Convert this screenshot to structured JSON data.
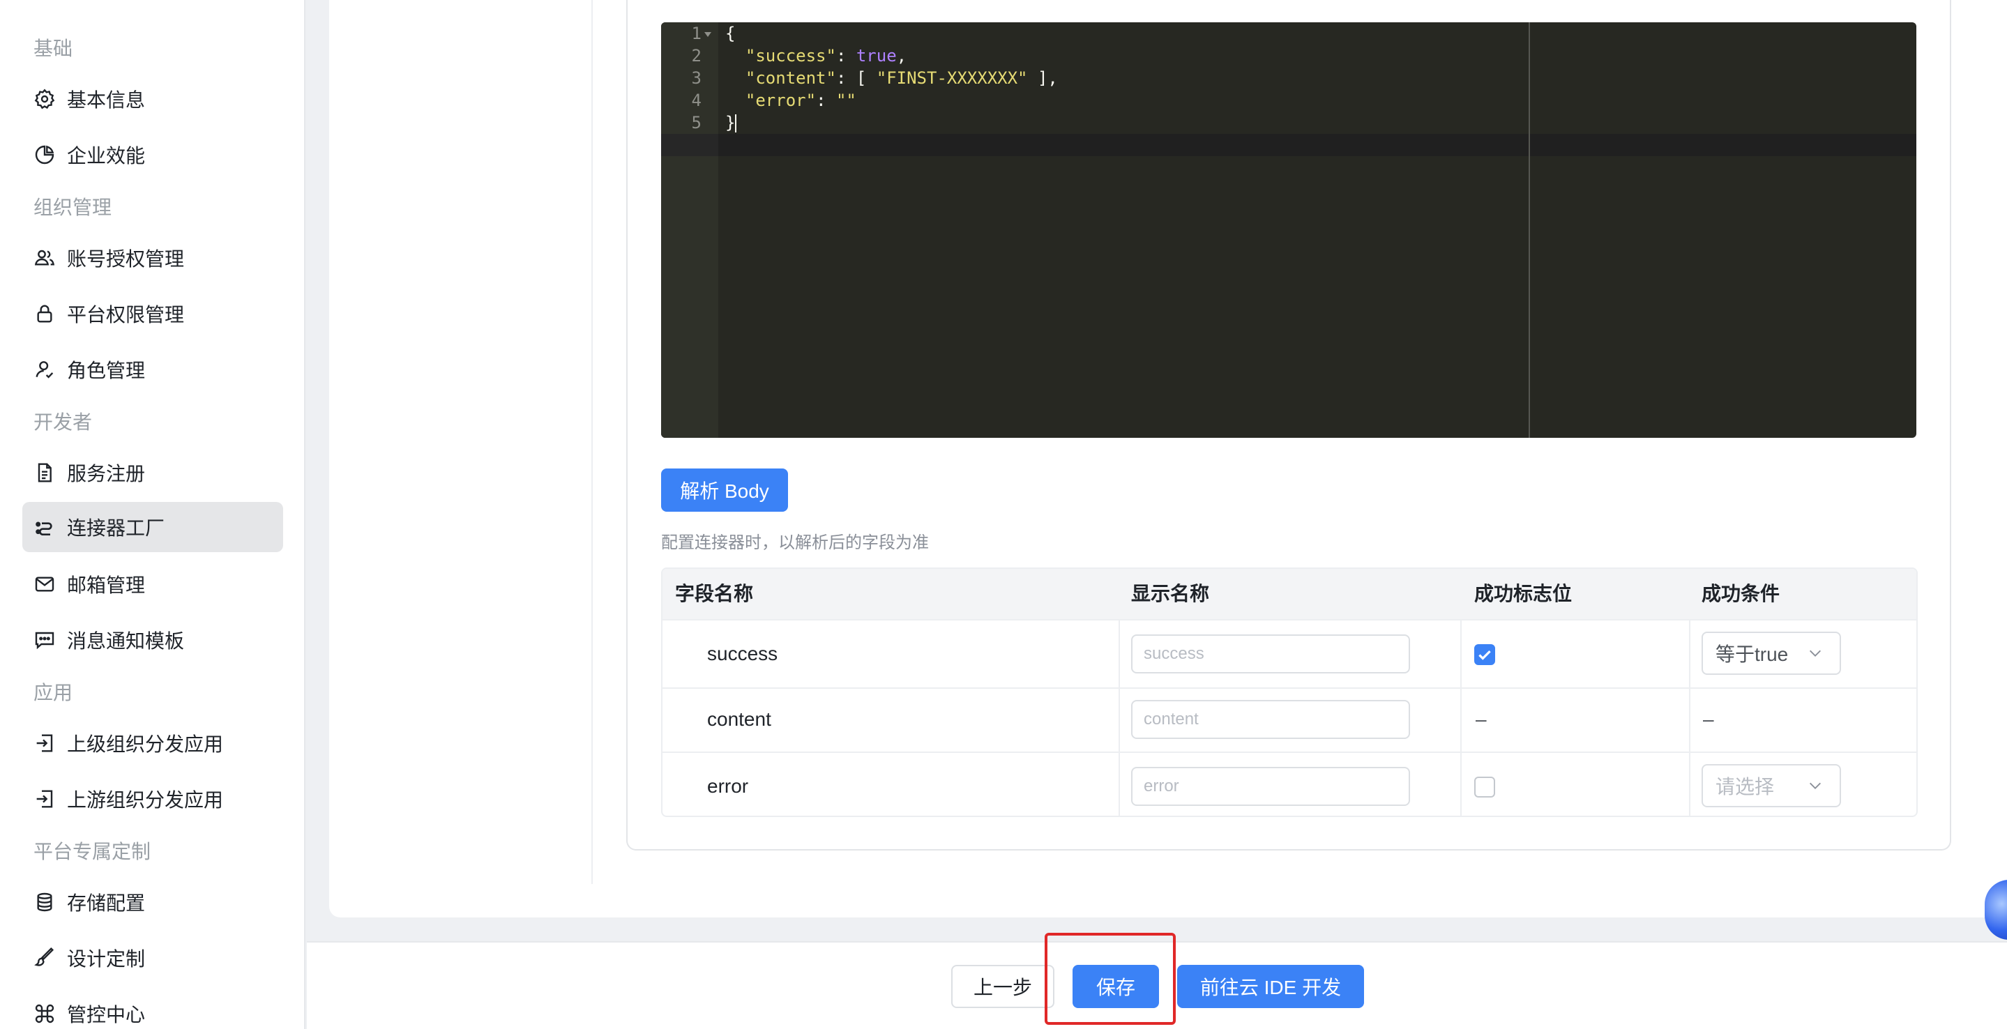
{
  "sidebar": {
    "groups": [
      "基础",
      "组织管理",
      "开发者",
      "应用",
      "平台专属定制"
    ],
    "items": [
      {
        "label": "基本信息",
        "icon": "gear-icon"
      },
      {
        "label": "企业效能",
        "icon": "pie-chart-icon"
      },
      {
        "label": "账号授权管理",
        "icon": "users-icon"
      },
      {
        "label": "平台权限管理",
        "icon": "lock-icon"
      },
      {
        "label": "角色管理",
        "icon": "user-icon"
      },
      {
        "label": "服务注册",
        "icon": "document-icon"
      },
      {
        "label": "连接器工厂",
        "icon": "connector-icon",
        "active": true
      },
      {
        "label": "邮箱管理",
        "icon": "mail-icon"
      },
      {
        "label": "消息通知模板",
        "icon": "message-icon"
      },
      {
        "label": "上级组织分发应用",
        "icon": "login-icon"
      },
      {
        "label": "上游组织分发应用",
        "icon": "login-icon"
      },
      {
        "label": "存储配置",
        "icon": "database-icon"
      },
      {
        "label": "设计定制",
        "icon": "brush-icon"
      },
      {
        "label": "管控中心",
        "icon": "command-icon"
      }
    ]
  },
  "editor": {
    "lines": [
      "1",
      "2",
      "3",
      "4",
      "5"
    ],
    "code": {
      "l1": "{",
      "k_success": "\"success\"",
      "v_true": "true",
      "k_content": "\"content\"",
      "v_first": "\"FINST-XXXXXXX\"",
      "k_error": "\"error\"",
      "v_empty": "\"\"",
      "l5": "}"
    }
  },
  "parse_button": "解析 Body",
  "hint": "配置连接器时，以解析后的字段为准",
  "table": {
    "headers": [
      "字段名称",
      "显示名称",
      "成功标志位",
      "成功条件"
    ],
    "rows": [
      {
        "field": "success",
        "placeholder": "success",
        "checked": true,
        "condition": "等于true"
      },
      {
        "field": "content",
        "placeholder": "content",
        "flag_dash": "–",
        "condition_dash": "–"
      },
      {
        "field": "error",
        "placeholder": "error",
        "checked": false,
        "condition_placeholder": "请选择"
      }
    ]
  },
  "footer": {
    "prev": "上一步",
    "save": "保存",
    "ide": "前往云 IDE 开发"
  },
  "colors": {
    "primary": "#3b82f6",
    "highlight": "#e02828",
    "editor_bg": "#272822"
  }
}
